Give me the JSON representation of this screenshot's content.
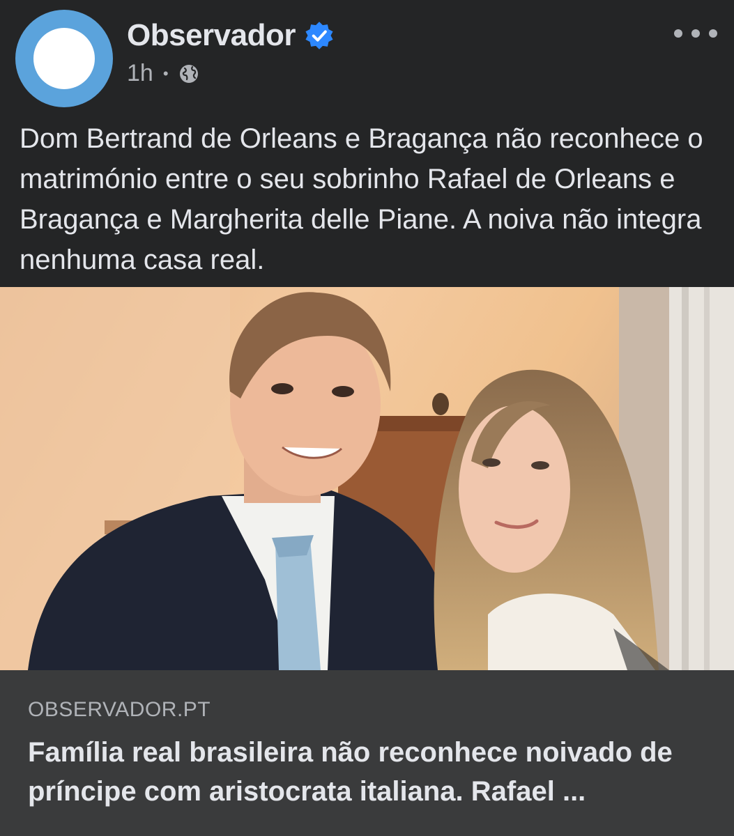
{
  "post": {
    "page_name": "Observador",
    "timestamp": "1h",
    "separator": "•",
    "privacy_icon": "globe-icon",
    "verified_icon": "verified-badge-icon",
    "more_icon": "more-options-icon",
    "text": "Dom Bertrand de Orleans e Bragança não reconhece o matrimónio entre o seu sobrinho Rafael de Orleans e Bragança e Margherita delle Piane. A noiva não integra nenhuma casa real."
  },
  "link_preview": {
    "domain": "OBSERVADOR.PT",
    "title": "Família real brasileira não reconhece noivado de príncipe com aristocrata italiana. Rafael ..."
  },
  "colors": {
    "background": "#242526",
    "avatar_ring": "#5ba3dc",
    "verified": "#2d88ff",
    "link_preview_bg": "#3a3b3c",
    "secondary_text": "#b0b3b8"
  }
}
